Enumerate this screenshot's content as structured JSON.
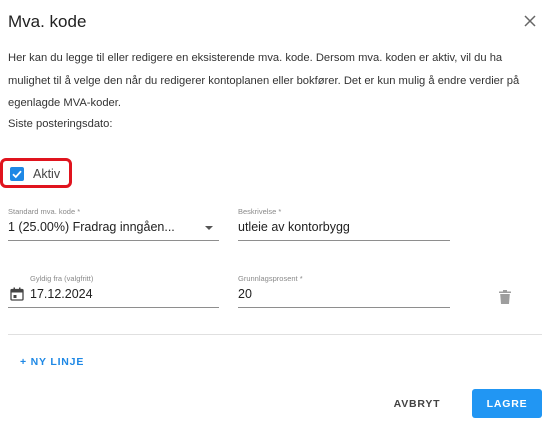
{
  "dialog": {
    "title": "Mva. kode",
    "description": "Her kan du legge til eller redigere en eksisterende mva. kode. Dersom mva. koden er aktiv, vil du ha mulighet til å velge den når du redigerer kontoplanen eller bokfører. Det er kun mulig å endre verdier på egenlagde MVA-koder.",
    "last_posting_label": "Siste posteringsdato:",
    "active": {
      "label": "Aktiv",
      "checked": true
    },
    "fields": {
      "standard_code": {
        "label": "Standard mva. kode *",
        "value": "1 (25.00%) Fradrag inngåen..."
      },
      "description": {
        "label": "Beskrivelse *",
        "value": "utleie av kontorbygg"
      },
      "valid_from": {
        "label": "Gyldig fra (valgfritt)",
        "value": "17.12.2024"
      },
      "basis_percent": {
        "label": "Grunnlagsprosent *",
        "value": "20"
      }
    },
    "add_line_label": "+ NY LINJE",
    "cancel_label": "AVBRYT",
    "save_label": "LAGRE"
  },
  "colors": {
    "accent": "#2196f3",
    "highlight": "#e0141e"
  },
  "icons": [
    "close-icon",
    "check-icon",
    "calendar-icon",
    "chevron-down-icon",
    "trash-icon"
  ]
}
